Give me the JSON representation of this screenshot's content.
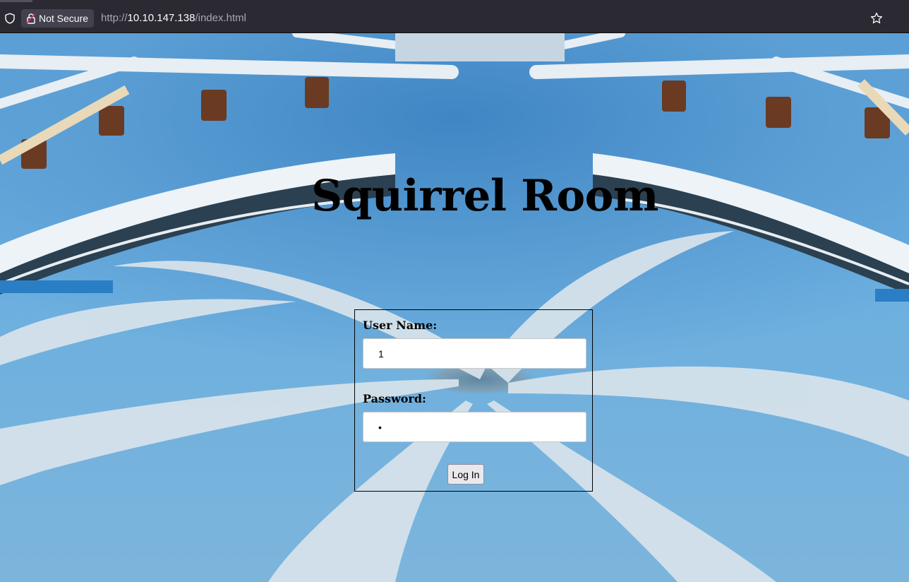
{
  "browser": {
    "security_label": "Not Secure",
    "url_prefix": "http://",
    "url_host": "10.10.147.138",
    "url_path": "/index.html"
  },
  "page": {
    "title": "Squirrel Room",
    "form": {
      "username_label": "User Name:",
      "username_value": "1",
      "password_label": "Password:",
      "password_value": "1",
      "submit_label": "Log In"
    }
  },
  "icons": {
    "shield": "shield-icon",
    "lock": "lock-insecure-icon",
    "bookmark": "star-icon"
  },
  "colors": {
    "chrome_bg": "#2b2a33",
    "security_bg": "#42414d",
    "background_blue": "#5a9ed6",
    "swirl_white": "#d8e4ea"
  }
}
